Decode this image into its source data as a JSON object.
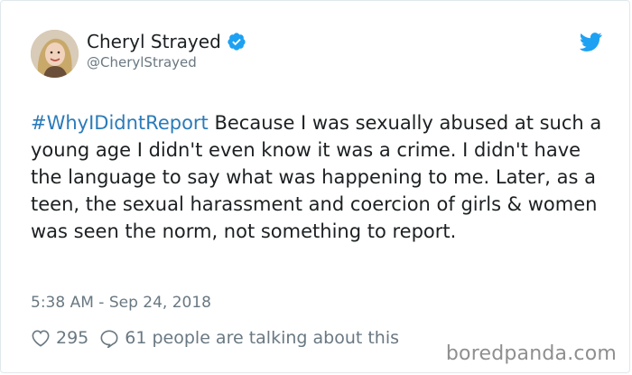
{
  "author": {
    "display_name": "Cheryl Strayed",
    "handle": "@CherylStrayed",
    "verified": true
  },
  "tweet": {
    "hashtag": "#WhyIDidntReport",
    "body": " Because I was sexually abused at such a young age I didn't even know it was a crime. I didn't have the language to say what was happening to me. Later, as a teen, the sexual harassment and coercion of girls & women was seen the norm, not something to report.",
    "timestamp": "5:38 AM - Sep 24, 2018"
  },
  "engagement": {
    "likes": "295",
    "replies_text": "61 people are talking about this"
  },
  "icons": {
    "brand": "twitter-bird-icon",
    "verified": "verified-badge-icon",
    "like": "heart-icon",
    "reply": "speech-bubble-icon"
  },
  "colors": {
    "twitter_blue": "#1da1f2",
    "hashtag": "#2b7bb9",
    "secondary_text": "#697882",
    "primary_text": "#1c2022"
  },
  "watermark": "boredpanda.com"
}
